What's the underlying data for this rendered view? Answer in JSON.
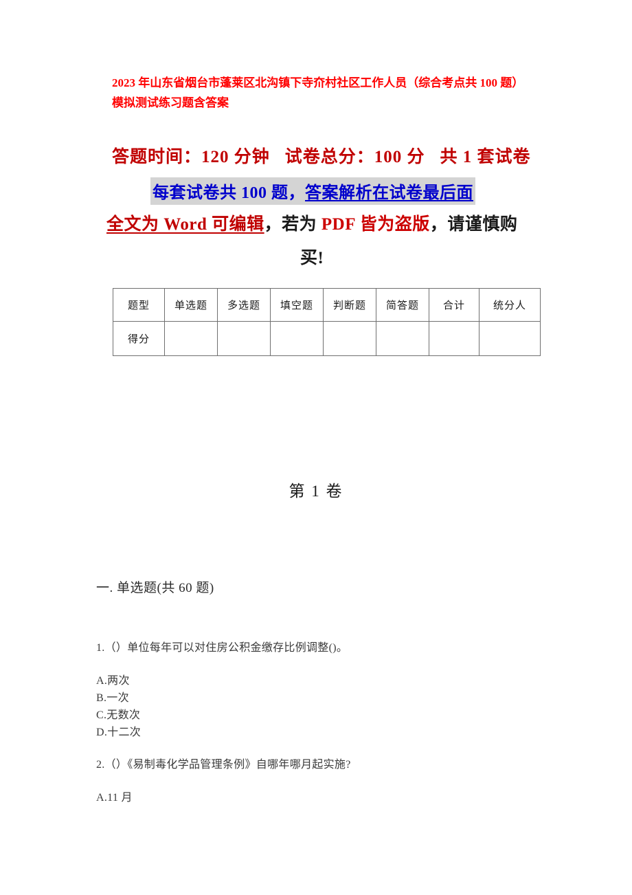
{
  "document": {
    "title": "2023 年山东省烟台市蓬莱区北沟镇下寺夼村社区工作人员（综合考点共 100 题）模拟测试练习题含答案",
    "exam_info": {
      "duration_label": "答题时间：120 分钟",
      "total_score_label": "试卷总分：100 分",
      "paper_count_label": "共 1 套试卷",
      "question_count_label": "每套试卷共 100 题，",
      "answer_location_label": "答案解析在试卷最后面",
      "format_notice_editable": "全文为 Word 可编辑",
      "format_notice_mid": "，若为 ",
      "format_notice_pirated": "PDF 皆为盗版",
      "format_notice_tail": "，请谨慎购",
      "format_notice_last_line": "买!"
    },
    "score_table": {
      "headers": [
        "题型",
        "单选题",
        "多选题",
        "填空题",
        "判断题",
        "简答题",
        "合计",
        "统分人"
      ],
      "rows": [
        {
          "label": "得分",
          "cells": [
            "",
            "",
            "",
            "",
            "",
            "",
            ""
          ]
        }
      ]
    },
    "volume_heading": "第 1 卷",
    "sections": [
      {
        "heading": "一. 单选题(共 60 题)",
        "questions": [
          {
            "text": "1.（）单位每年可以对住房公积金缴存比例调整()。",
            "options": [
              "A.两次",
              "B.一次",
              "C.无数次",
              "D.十二次"
            ]
          },
          {
            "text": "2.（）《易制毒化学品管理条例》自哪年哪月起实施?",
            "options": [
              "A.11 月"
            ]
          }
        ]
      }
    ],
    "colors": {
      "title_red": "#ff0000",
      "heading_dark_red": "#c00000",
      "link_blue": "#0000cc",
      "highlight_grey": "#d4d4d4",
      "body_text": "#3a3a3a"
    }
  }
}
